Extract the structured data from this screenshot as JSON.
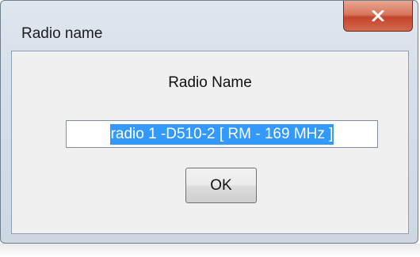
{
  "window": {
    "title": "Radio name",
    "close_icon": "close-icon"
  },
  "dialog": {
    "heading": "Radio Name",
    "input_value": "radio 1 -D510-2 [ RM - 169 MHz ]",
    "ok_label": "OK"
  },
  "colors": {
    "selection_highlight": "#3399ff",
    "close_button": "#c4452c"
  }
}
